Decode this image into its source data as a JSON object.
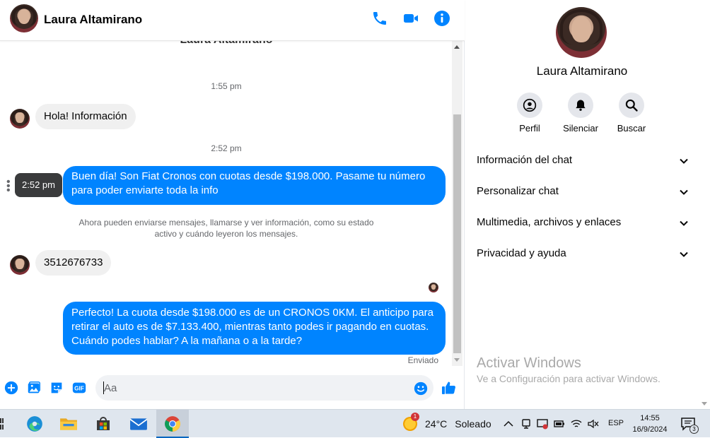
{
  "colors": {
    "accent": "#0084ff",
    "bubble_in": "#f0f0f0",
    "bubble_out": "#0084ff"
  },
  "header": {
    "contact_name": "Laura Altamirano",
    "icons": [
      "phone-icon",
      "video-camera-icon",
      "info-icon"
    ]
  },
  "conversation": {
    "top_name": "Laura Altamirano",
    "messages": [
      {
        "type": "timestamp",
        "text": "1:55 pm"
      },
      {
        "type": "incoming",
        "text": "Hola! Información"
      },
      {
        "type": "timestamp",
        "text": "2:52 pm"
      },
      {
        "type": "outgoing",
        "line1": "Buen día! Son Fiat Cronos con cuotas desde $198.000. Pasame tu número",
        "line2": "para poder enviarte toda la info"
      },
      {
        "type": "notice",
        "line1": "Ahora pueden enviarse mensajes, llamarse y ver información, como su estado",
        "line2": "activo y cuándo leyeron los mensajes."
      },
      {
        "type": "incoming",
        "text": "3512676733"
      },
      {
        "type": "outgoing",
        "line1": "Perfecto! La cuota desde $198.000 es de un CRONOS 0KM. El anticipo para",
        "line2": "retirar el auto es de $7.133.400, mientras tanto podes ir pagando en cuotas.",
        "line3": "Cuándo podes hablar? A la mañana o a la tarde?"
      }
    ],
    "tooltip_time": "2:52 pm",
    "sent_status": "Enviado"
  },
  "composer": {
    "placeholder": "Aa",
    "gif_label": "GIF",
    "icons": [
      "plus-circle-icon",
      "image-icon",
      "sticker-icon",
      "gif-icon",
      "emoji-icon",
      "thumbs-up-icon"
    ]
  },
  "panel": {
    "contact_name": "Laura Altamirano",
    "actions": [
      {
        "label": "Perfil",
        "icon": "profile-icon"
      },
      {
        "label": "Silenciar",
        "icon": "bell-icon"
      },
      {
        "label": "Buscar",
        "icon": "search-icon"
      }
    ],
    "sections": [
      "Información del chat",
      "Personalizar chat",
      "Multimedia, archivos y enlaces",
      "Privacidad y ayuda"
    ],
    "watermark_title": "Activar Windows",
    "watermark_sub": "Ve a Configuración para activar Windows."
  },
  "taskbar": {
    "apps": [
      "edge-icon",
      "file-explorer-icon",
      "store-icon",
      "mail-icon",
      "chrome-icon"
    ],
    "weather": {
      "badge": "1",
      "temp": "24°C",
      "desc": "Soleado"
    },
    "language": "ESP",
    "time": "14:55",
    "date": "16/9/2024",
    "notification_count": "3"
  }
}
